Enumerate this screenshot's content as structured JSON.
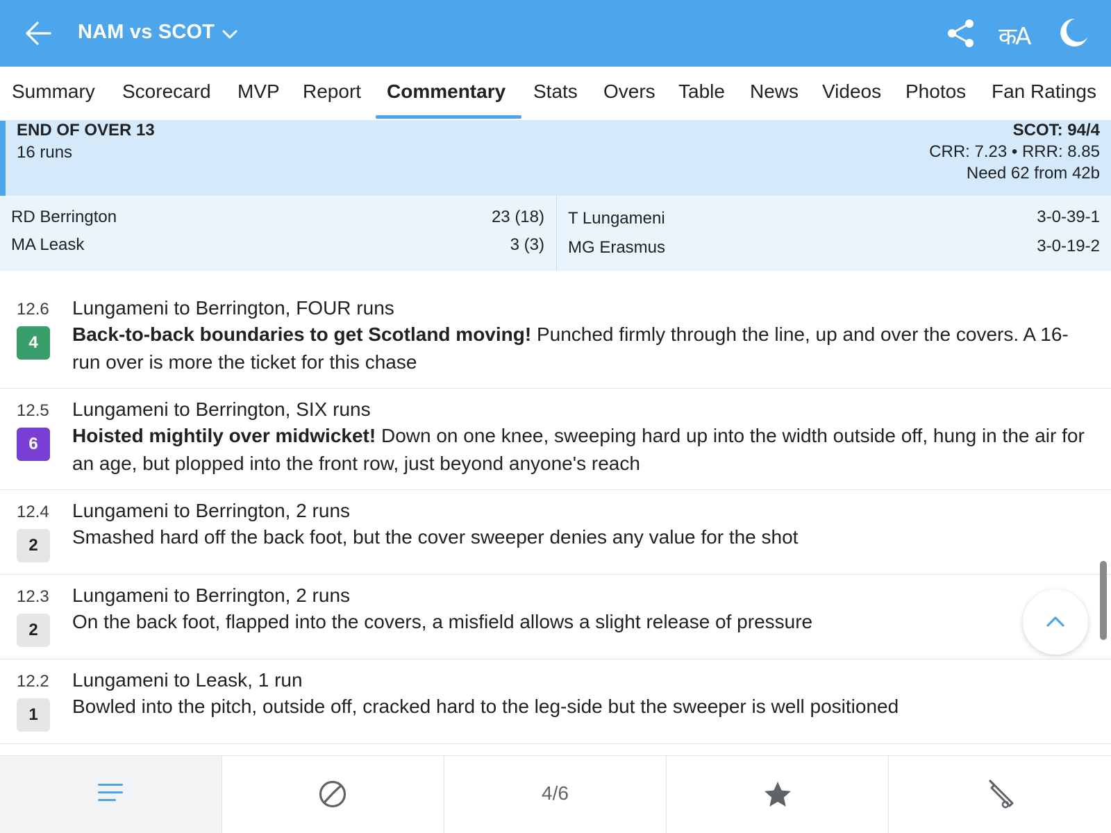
{
  "header": {
    "title": "NAM vs SCOT",
    "icons": [
      "back-arrow-icon",
      "chevron-down-icon",
      "share-icon",
      "language-icon",
      "dark-mode-moon-icon"
    ],
    "language_label": "कA",
    "color": "#4da6ec"
  },
  "tabs": [
    {
      "label": "Summary",
      "active": false
    },
    {
      "label": "Scorecard",
      "active": false
    },
    {
      "label": "MVP",
      "active": false
    },
    {
      "label": "Report",
      "active": false
    },
    {
      "label": "Commentary",
      "active": true
    },
    {
      "label": "Stats",
      "active": false
    },
    {
      "label": "Overs",
      "active": false
    },
    {
      "label": "Table",
      "active": false
    },
    {
      "label": "News",
      "active": false
    },
    {
      "label": "Videos",
      "active": false
    },
    {
      "label": "Photos",
      "active": false
    },
    {
      "label": "Fan Ratings",
      "active": false
    }
  ],
  "over_summary": {
    "title": "END OF OVER 13",
    "runs": "16 runs",
    "score": "SCOT: 94/4",
    "rates": "CRR: 7.23 • RRR: 8.85",
    "need": "Need 62 from 42b"
  },
  "batters": [
    {
      "name": "RD Berrington",
      "stat": "23 (18)"
    },
    {
      "name": "MA Leask",
      "stat": "3 (3)"
    }
  ],
  "bowlers": [
    {
      "name": "T Lungameni",
      "stat": "3-0-39-1"
    },
    {
      "name": "MG Erasmus",
      "stat": "3-0-19-2"
    }
  ],
  "commentary": [
    {
      "ball": "12.6",
      "runs_badge": "4",
      "headline": "Lungameni to Berrington, FOUR runs",
      "bold": "Back-to-back boundaries to get Scotland moving!",
      "text": " Punched firmly through the line, up and over the covers. A 16-run over is more the ticket for this chase"
    },
    {
      "ball": "12.5",
      "runs_badge": "6",
      "headline": "Lungameni to Berrington, SIX runs",
      "bold": "Hoisted mightily over midwicket!",
      "text": " Down on one knee, sweeping hard up into the width outside off, hung in the air for an age, but plopped into the front row, just beyond anyone's reach"
    },
    {
      "ball": "12.4",
      "runs_badge": "2",
      "headline": "Lungameni to Berrington, 2 runs",
      "bold": "",
      "text": "Smashed hard off the back foot, but the cover sweeper denies any value for the shot"
    },
    {
      "ball": "12.3",
      "runs_badge": "2",
      "headline": "Lungameni to Berrington, 2 runs",
      "bold": "",
      "text": "On the back foot, flapped into the covers, a misfield allows a slight release of pressure"
    },
    {
      "ball": "12.2",
      "runs_badge": "1",
      "headline": "Lungameni to Leask, 1 run",
      "bold": "",
      "text": "Bowled into the pitch, outside off, cracked hard to the leg-side but the sweeper is well positioned"
    }
  ],
  "badge_colors": {
    "four": "#3a9e6b",
    "six": "#7a3fd6",
    "other": "#e6e6e6"
  },
  "bottom_bar": {
    "items": [
      "commentary-lines-icon",
      "ball-icon",
      "page-indicator",
      "star-icon",
      "bat-icon"
    ],
    "page_indicator": "4/6"
  },
  "scroll_top_icon": "chevron-up-icon"
}
